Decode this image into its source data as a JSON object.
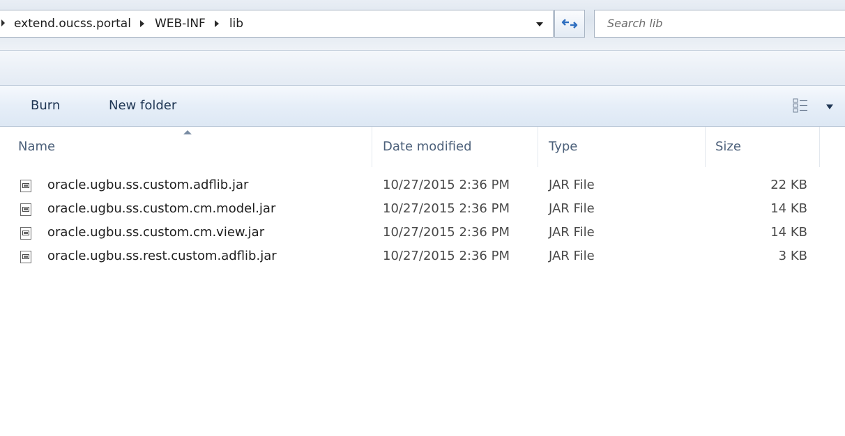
{
  "address_bar": {
    "breadcrumbs": [
      "extend.oucss.portal",
      "WEB-INF",
      "lib"
    ]
  },
  "search": {
    "placeholder": "Search lib"
  },
  "toolbar": {
    "burn_label": "Burn",
    "new_folder_label": "New folder"
  },
  "columns": {
    "name": "Name",
    "date_modified": "Date modified",
    "type": "Type",
    "size": "Size"
  },
  "files": [
    {
      "name": "oracle.ugbu.ss.custom.adflib.jar",
      "date_modified": "10/27/2015 2:36 PM",
      "type": "JAR File",
      "size": "22 KB"
    },
    {
      "name": "oracle.ugbu.ss.custom.cm.model.jar",
      "date_modified": "10/27/2015 2:36 PM",
      "type": "JAR File",
      "size": "14 KB"
    },
    {
      "name": "oracle.ugbu.ss.custom.cm.view.jar",
      "date_modified": "10/27/2015 2:36 PM",
      "type": "JAR File",
      "size": "14 KB"
    },
    {
      "name": "oracle.ugbu.ss.rest.custom.adflib.jar",
      "date_modified": "10/27/2015 2:36 PM",
      "type": "JAR File",
      "size": "3 KB"
    }
  ],
  "icons": {
    "file": "jar-file-icon",
    "refresh": "refresh-icon",
    "views": "views-icon",
    "dropdown": "chevron-down-icon"
  },
  "colors": {
    "toolbar_text": "#1e3553",
    "header_text": "#4c607a",
    "toolbar_bg": "#e6eef8"
  }
}
